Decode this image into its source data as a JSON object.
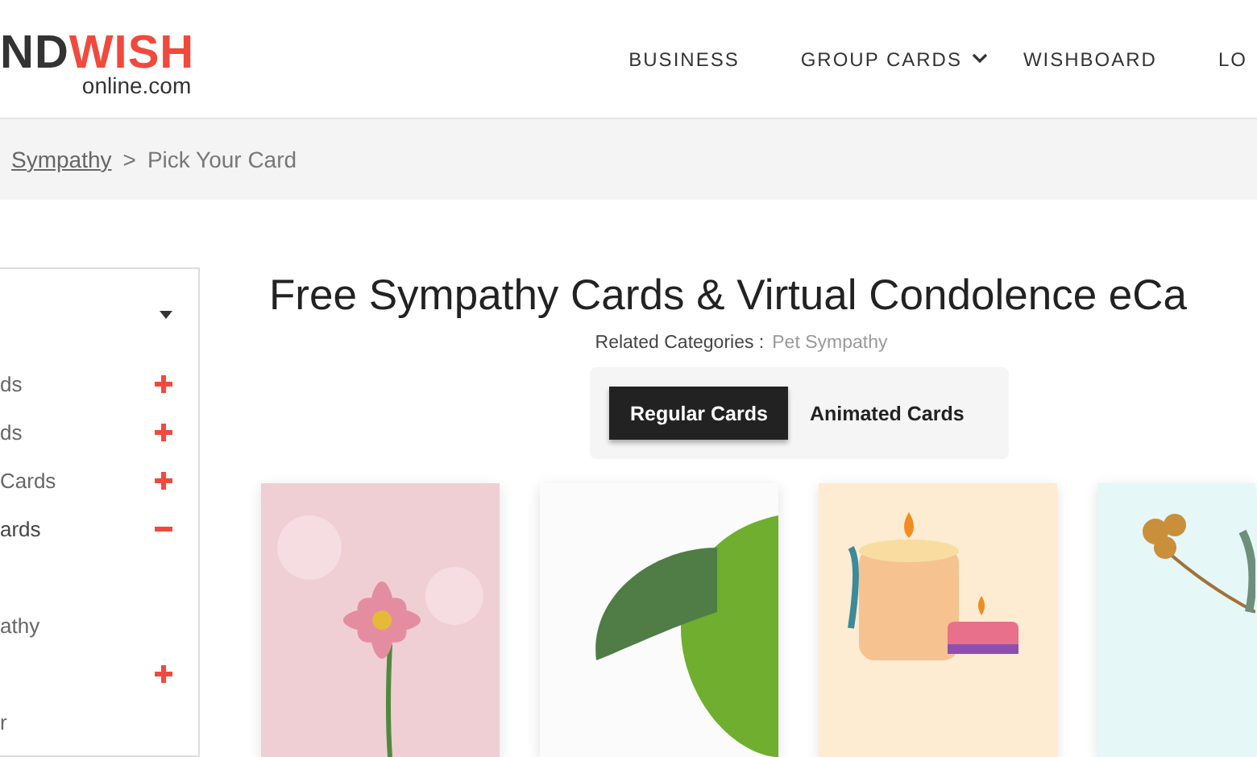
{
  "header": {
    "logo": {
      "dark": "ND",
      "accent": "WISH",
      "sub": "online.com"
    },
    "nav": [
      {
        "label": "BUSINESS",
        "dropdown": false
      },
      {
        "label": "GROUP CARDS",
        "dropdown": true
      },
      {
        "label": "WISHBOARD",
        "dropdown": false
      },
      {
        "label": "LO",
        "dropdown": false
      }
    ]
  },
  "breadcrumb": {
    "link": "Sympathy",
    "separator": ">",
    "current": "Pick Your Card"
  },
  "sidebar": {
    "items": [
      {
        "label": "ds",
        "expanded": false
      },
      {
        "label": "ds",
        "expanded": false
      },
      {
        "label": "Cards",
        "expanded": false
      },
      {
        "label": "ards",
        "expanded": true,
        "children": [
          {
            "label": "athy"
          }
        ]
      },
      {
        "expanded": false
      },
      {
        "label": "r"
      }
    ]
  },
  "main": {
    "title": "Free Sympathy Cards & Virtual Condolence eCa",
    "related_label": "Related Categories :",
    "related_link": "Pet Sympathy",
    "tabs": [
      {
        "label": "Regular Cards",
        "selected": true
      },
      {
        "label": "Animated Cards",
        "selected": false
      }
    ],
    "cards": [
      {
        "kind": "flower"
      },
      {
        "kind": "leaf"
      },
      {
        "kind": "candle"
      },
      {
        "kind": "bouquet"
      }
    ]
  }
}
